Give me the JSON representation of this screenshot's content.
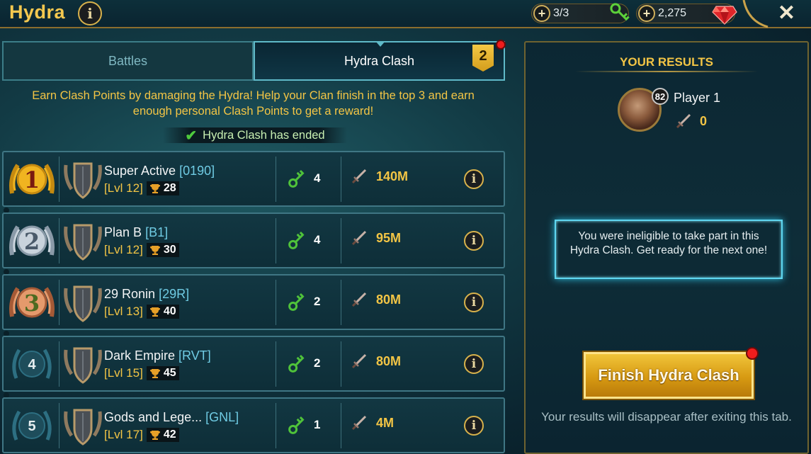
{
  "header": {
    "title": "Hydra",
    "info_label": "i",
    "keys_resource": "3/3",
    "gems_resource": "2,275",
    "plus_label": "+",
    "close_label": "✕"
  },
  "tabs": [
    {
      "label": "Battles",
      "active": false
    },
    {
      "label": "Hydra Clash",
      "active": true,
      "badge": "2"
    }
  ],
  "intro_text": "Earn Clash Points by damaging the Hydra! Help your Clan finish in the top 3 and earn enough personal Clash Points to get a reward!",
  "status": {
    "text": "Hydra Clash has ended",
    "icon": "check-icon"
  },
  "clans": [
    {
      "rank": "1",
      "name": "Super Active",
      "tag": "[0190]",
      "level": "[Lvl 12]",
      "trophies": "28",
      "keys": "4",
      "damage": "140M"
    },
    {
      "rank": "2",
      "name": "Plan B",
      "tag": "[B1]",
      "level": "[Lvl 12]",
      "trophies": "30",
      "keys": "4",
      "damage": "95M"
    },
    {
      "rank": "3",
      "name": "29 Ronin",
      "tag": "[29R]",
      "level": "[Lvl 13]",
      "trophies": "40",
      "keys": "2",
      "damage": "80M"
    },
    {
      "rank": "4",
      "name": "Dark Empire",
      "tag": "[RVT]",
      "level": "[Lvl 15]",
      "trophies": "45",
      "keys": "2",
      "damage": "80M"
    },
    {
      "rank": "5",
      "name": "Gods and Lege...",
      "tag": "[GNL]",
      "level": "[Lvl 17]",
      "trophies": "42",
      "keys": "1",
      "damage": "4M"
    }
  ],
  "results_panel": {
    "title": "YOUR RESULTS",
    "player_level": "82",
    "player_name": "Player 1",
    "player_points": "0",
    "notice": "You were ineligible to take part in this Hydra Clash. Get ready for the next one!",
    "finish_button": "Finish Hydra Clash",
    "footer": "Your results will disappear after exiting this tab."
  },
  "colors": {
    "accent_gold": "#f3c545",
    "tag_cyan": "#6fcbe3",
    "notice_glow": "#5fd6ef",
    "alert_red": "#ef1d1d"
  }
}
